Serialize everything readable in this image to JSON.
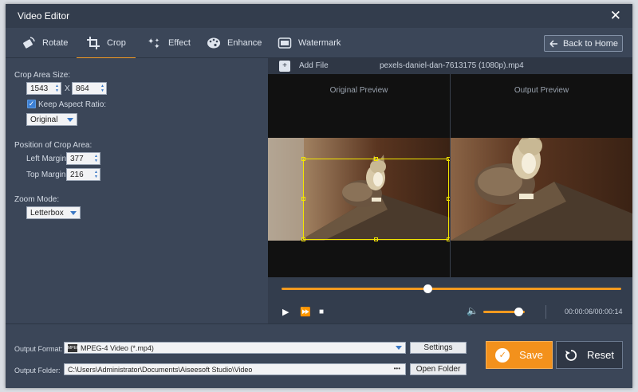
{
  "window": {
    "title": "Video Editor"
  },
  "tabs": [
    {
      "label": "Rotate",
      "icon": "rotate-icon"
    },
    {
      "label": "Crop",
      "icon": "crop-icon",
      "active": true
    },
    {
      "label": "Effect",
      "icon": "effect-icon"
    },
    {
      "label": "Enhance",
      "icon": "enhance-icon"
    },
    {
      "label": "Watermark",
      "icon": "watermark-icon"
    }
  ],
  "back_home": "Back to Home",
  "crop": {
    "area_size_label": "Crop Area Size:",
    "width": "1543",
    "x_sep": "X",
    "height": "864",
    "keep_aspect_label": "Keep Aspect Ratio:",
    "keep_aspect_checked": true,
    "aspect_value": "Original",
    "position_label": "Position of Crop Area:",
    "left_margin_label": "Left Margin:",
    "left_margin": "377",
    "top_margin_label": "Top Margin:",
    "top_margin": "216",
    "zoom_mode_label": "Zoom Mode:",
    "zoom_mode": "Letterbox"
  },
  "file": {
    "add_label": "Add File",
    "name": "pexels-daniel-dan-7613175 (1080p).mp4"
  },
  "preview": {
    "original_label": "Original Preview",
    "output_label": "Output Preview"
  },
  "player": {
    "time": "00:00:06/00:00:14",
    "seek_progress": 0.43,
    "volume": 0.85
  },
  "output": {
    "format_label": "Output Format:",
    "format_value": "MPEG-4 Video (*.mp4)",
    "format_icon_text": "MPEG",
    "settings_label": "Settings",
    "folder_label": "Output Folder:",
    "folder_value": "C:\\Users\\Administrator\\Documents\\Aiseesoft Studio\\Video",
    "folder_dots": "•••",
    "open_folder_label": "Open Folder"
  },
  "actions": {
    "save_label": "Save",
    "reset_label": "Reset"
  },
  "colors": {
    "accent": "#f3911c",
    "crop_frame": "#f2e600",
    "panel": "#3b4658"
  }
}
